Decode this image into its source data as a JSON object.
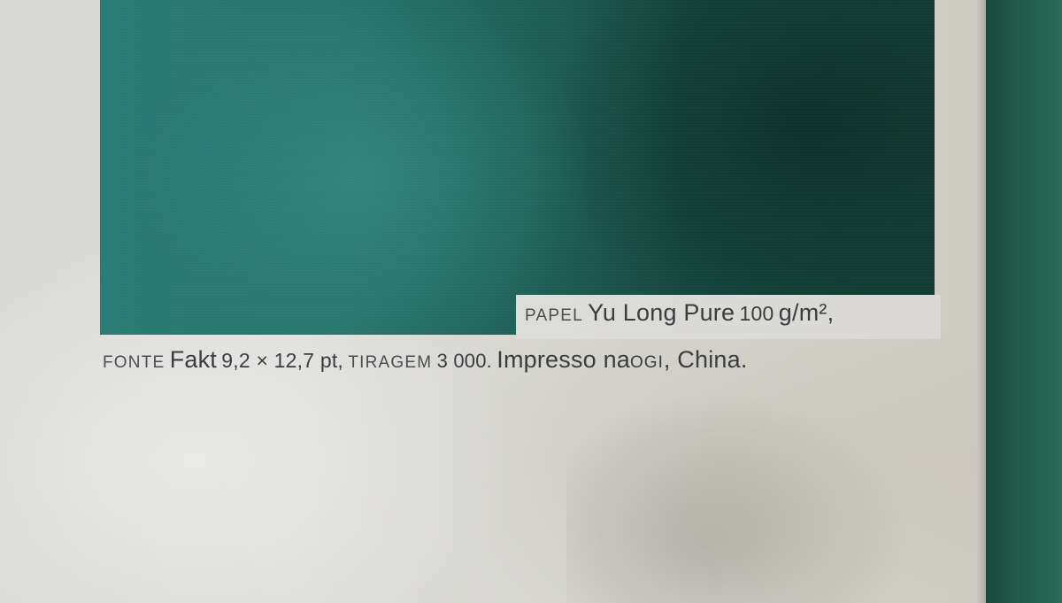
{
  "colophon": {
    "line1": {
      "label_papel": "PAPEL",
      "paper_name": "Yu Long Pure",
      "paper_weight": "100",
      "paper_unit": "g/m²,"
    },
    "line2": {
      "label_fonte": "FONTE",
      "font_name": "Fakt",
      "font_size": "9,2 × 12,7 pt,",
      "label_tiragem": "TIRAGEM",
      "print_run": "3 000.",
      "impresso": "Impresso na",
      "printer": "OGI",
      "location": ", China."
    }
  },
  "colors": {
    "photo_teal": "#2a7c74",
    "photo_dark": "#143e36",
    "paper": "#d9d9d6",
    "text": "#3b3e3f",
    "cover_green": "#205a4a"
  }
}
